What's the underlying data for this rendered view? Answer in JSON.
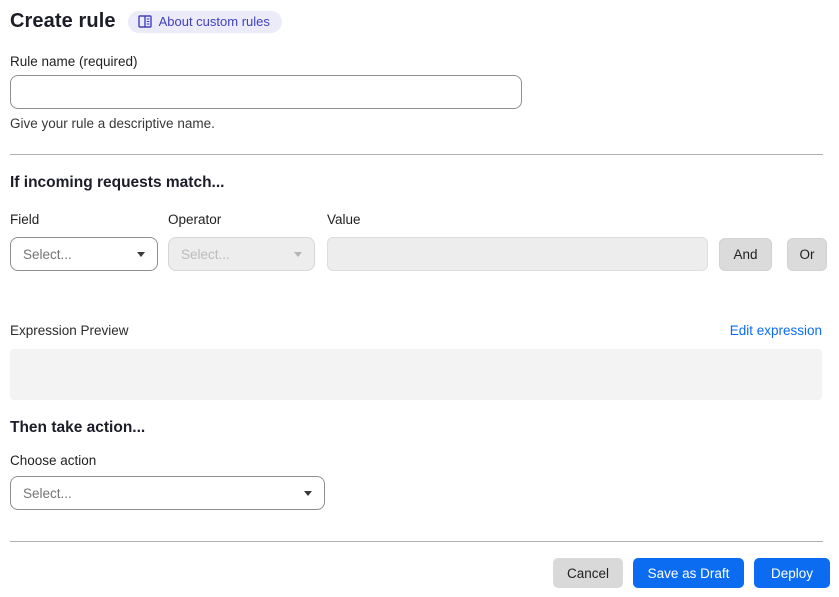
{
  "header": {
    "title": "Create rule",
    "about_link": "About custom rules"
  },
  "rule_name": {
    "label": "Rule name (required)",
    "value": "",
    "help": "Give your rule a descriptive name."
  },
  "match_section": {
    "heading": "If incoming requests match...",
    "field": {
      "label": "Field",
      "placeholder": "Select..."
    },
    "operator": {
      "label": "Operator",
      "placeholder": "Select..."
    },
    "value": {
      "label": "Value",
      "value": ""
    },
    "and_button": "And",
    "or_button": "Or",
    "expression_preview_label": "Expression Preview",
    "edit_expression_link": "Edit expression",
    "expression_value": ""
  },
  "action_section": {
    "heading": "Then take action...",
    "choose_action_label": "Choose action",
    "action_placeholder": "Select..."
  },
  "footer": {
    "cancel": "Cancel",
    "save_draft": "Save as Draft",
    "deploy": "Deploy"
  },
  "colors": {
    "primary_blue": "#0b6cf2",
    "link_blue": "#0b6cf2",
    "badge_bg": "#ebebfa",
    "badge_text": "#4141c0",
    "disabled_bg": "#ededed",
    "gray_button": "#d9d9d9",
    "divider": "#b1b1b1",
    "expression_box_bg": "#f3f3f3"
  }
}
